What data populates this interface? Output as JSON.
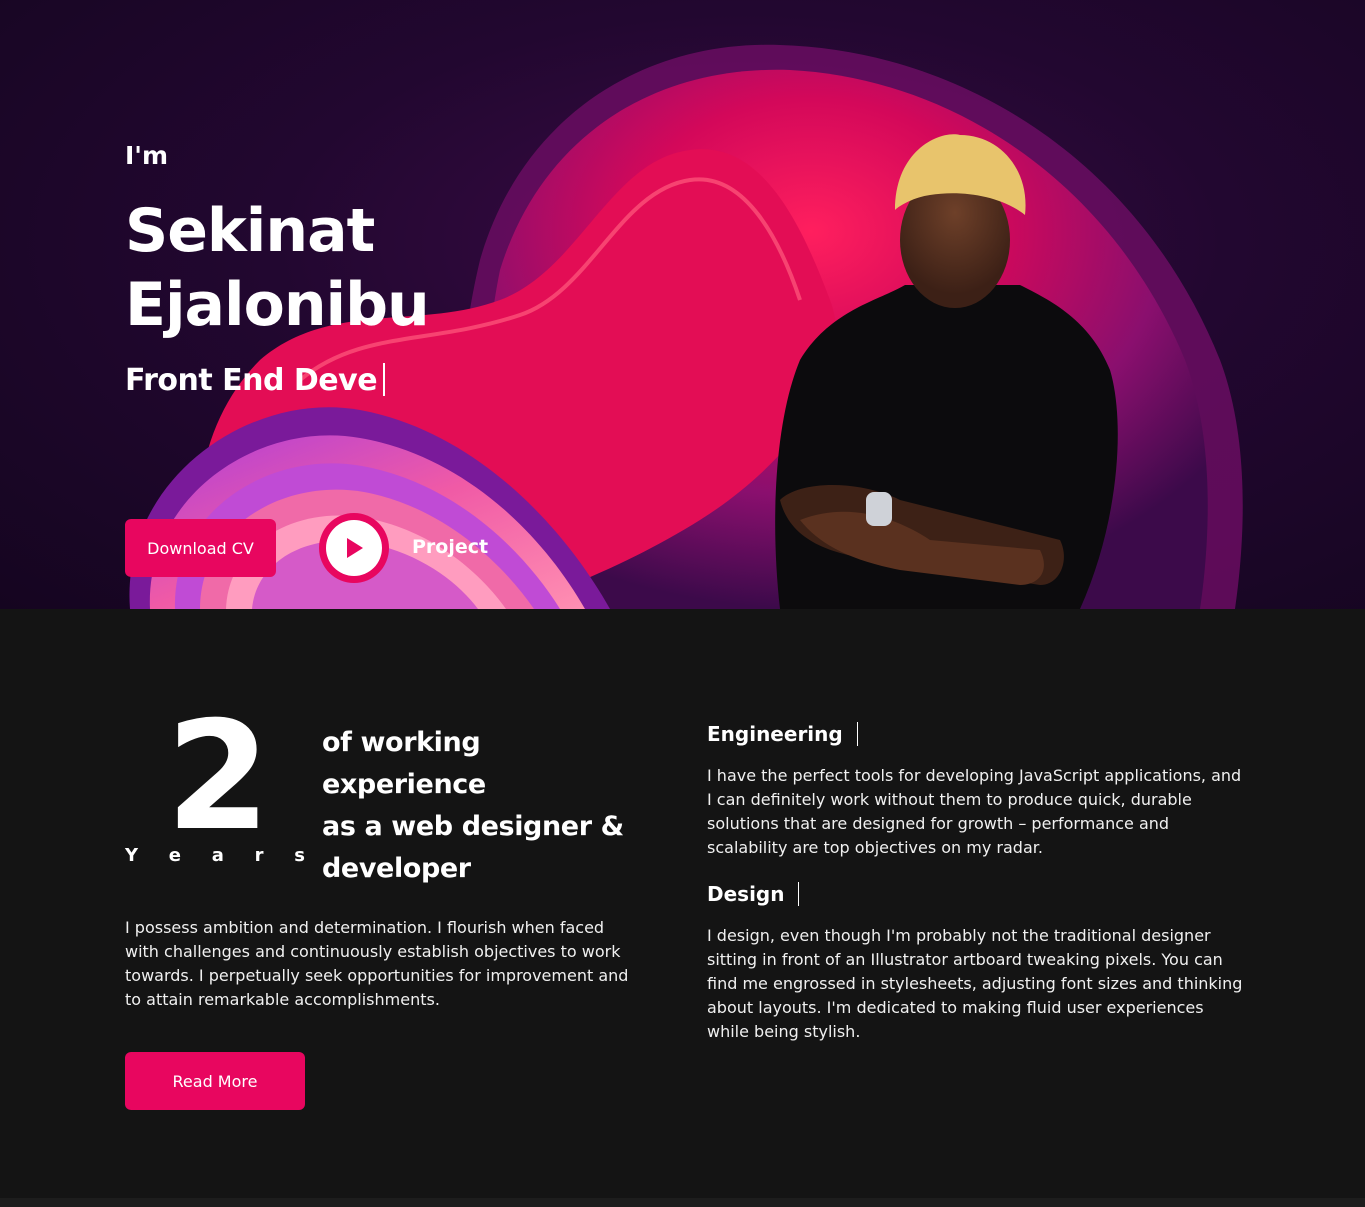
{
  "hero": {
    "greeting": "I'm",
    "name_line1": "Sekinat",
    "name_line2": "Ejalonibu",
    "role_typed": "Front End Deve",
    "download_label": "Download CV",
    "project_label": "Project"
  },
  "experience": {
    "years_number": "2",
    "years_letters": [
      "Y",
      "e",
      "a",
      "r",
      "s"
    ],
    "line1": "of working experience",
    "line2": "as a web designer &",
    "line3": "developer",
    "paragraph": "I possess ambition and determination. I flourish when faced with challenges and continuously establish objectives to work towards. I perpetually seek opportunities for improvement and to attain remarkable accomplishments.",
    "read_more_label": "Read More"
  },
  "skills": [
    {
      "title": "Engineering",
      "text": "I have the perfect tools for developing JavaScript applications, and I can definitely work without them to produce quick, durable solutions that are designed for growth – performance and scalability are top objectives on my radar."
    },
    {
      "title": "Design",
      "text": "I design, even though I'm probably not the traditional designer sitting in front of an Illustrator artboard tweaking pixels. You can find me engrossed in stylesheets, adjusting font sizes and thinking about layouts. I'm dedicated to making fluid user experiences while being stylish."
    }
  ],
  "colors": {
    "accent": "#e8065f",
    "hero_bg": "#1a0626",
    "section_bg": "#141414",
    "text": "#ffffff"
  },
  "icons": {
    "play": "play-icon"
  }
}
